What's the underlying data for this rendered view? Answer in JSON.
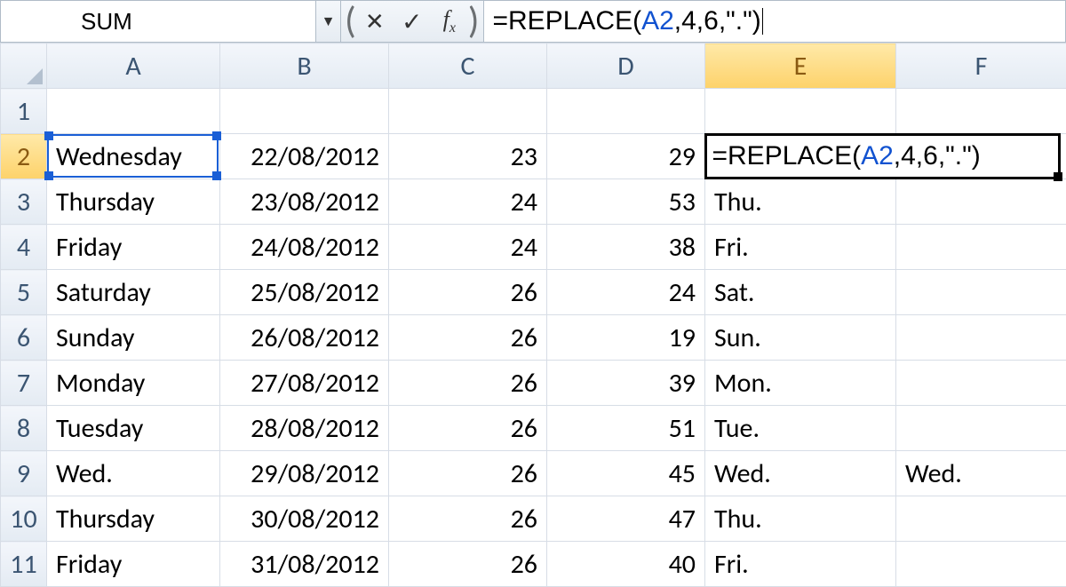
{
  "namebox": {
    "value": "SUM"
  },
  "formula_bar": {
    "prefix": "=REPLACE(",
    "ref": "A2",
    "suffix": ",4,6,\".\")"
  },
  "active": {
    "row": 2,
    "col": "E"
  },
  "range_ref": {
    "row": 2,
    "col": "A"
  },
  "columns": [
    "A",
    "B",
    "C",
    "D",
    "E",
    "F"
  ],
  "rows": [
    {
      "n": 1,
      "A": "",
      "B": "",
      "C": "",
      "D": "",
      "E": "",
      "F": ""
    },
    {
      "n": 2,
      "A": "Wednesday",
      "B": "22/08/2012",
      "C": "23",
      "D": "29",
      "E": "",
      "F": ""
    },
    {
      "n": 3,
      "A": "Thursday",
      "B": "23/08/2012",
      "C": "24",
      "D": "53",
      "E": "Thu.",
      "F": ""
    },
    {
      "n": 4,
      "A": "Friday",
      "B": "24/08/2012",
      "C": "24",
      "D": "38",
      "E": "Fri.",
      "F": ""
    },
    {
      "n": 5,
      "A": "Saturday",
      "B": "25/08/2012",
      "C": "26",
      "D": "24",
      "E": "Sat.",
      "F": ""
    },
    {
      "n": 6,
      "A": "Sunday",
      "B": "26/08/2012",
      "C": "26",
      "D": "19",
      "E": "Sun.",
      "F": ""
    },
    {
      "n": 7,
      "A": "Monday",
      "B": "27/08/2012",
      "C": "26",
      "D": "39",
      "E": "Mon.",
      "F": ""
    },
    {
      "n": 8,
      "A": "Tuesday",
      "B": "28/08/2012",
      "C": "26",
      "D": "51",
      "E": "Tue.",
      "F": ""
    },
    {
      "n": 9,
      "A": "Wed.",
      "B": "29/08/2012",
      "C": "26",
      "D": "45",
      "E": "Wed.",
      "F": "Wed."
    },
    {
      "n": 10,
      "A": "Thursday",
      "B": "30/08/2012",
      "C": "26",
      "D": "47",
      "E": "Thu.",
      "F": ""
    },
    {
      "n": 11,
      "A": "Friday",
      "B": "31/08/2012",
      "C": "26",
      "D": "40",
      "E": "Fri.",
      "F": ""
    }
  ],
  "editing_cell": {
    "prefix": "=REPLACE(",
    "ref": "A2",
    "suffix": ",4,6,\".\")"
  },
  "icons": {
    "dropdown": "▼",
    "cancel": "✕",
    "enter": "✓",
    "fx": "fx"
  }
}
